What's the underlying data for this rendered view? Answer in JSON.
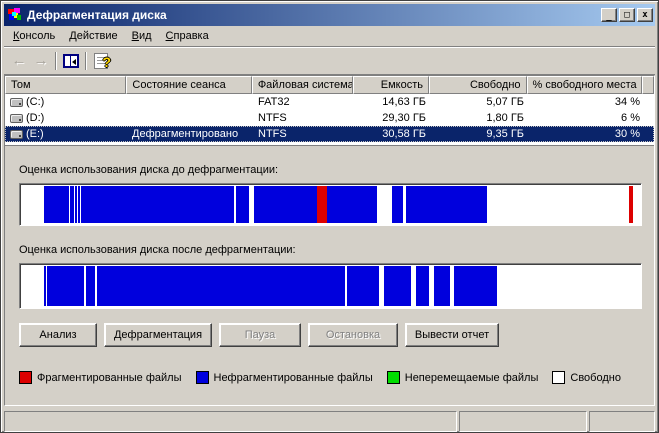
{
  "window": {
    "title": "Дефрагментация диска",
    "controls": {
      "minimize": "_",
      "maximize": "□",
      "close": "x"
    }
  },
  "menu": {
    "items": [
      {
        "label": "Консоль"
      },
      {
        "label": "Действие"
      },
      {
        "label": "Вид"
      },
      {
        "label": "Справка"
      }
    ]
  },
  "toolbar": {
    "icons": [
      "back-arrow",
      "forward-arrow",
      "show-console-tree",
      "help"
    ],
    "back_glyph": "←",
    "forward_glyph": "→",
    "help_glyph": "?"
  },
  "table": {
    "columns": [
      {
        "label": "Том"
      },
      {
        "label": "Состояние сеанса"
      },
      {
        "label": "Файловая система"
      },
      {
        "label": "Емкость"
      },
      {
        "label": "Свободно"
      },
      {
        "label": "% свободного места"
      }
    ],
    "rows": [
      {
        "volume": "(C:)",
        "session_status": "",
        "file_system": "FAT32",
        "capacity": "14,63 ГБ",
        "free_space": "5,07 ГБ",
        "percent_free": "34 %",
        "selected": false
      },
      {
        "volume": "(D:)",
        "session_status": "",
        "file_system": "NTFS",
        "capacity": "29,30 ГБ",
        "free_space": "1,80 ГБ",
        "percent_free": "6 %",
        "selected": false
      },
      {
        "volume": "(E:)",
        "session_status": "Дефрагментировано",
        "file_system": "NTFS",
        "capacity": "30,58 ГБ",
        "free_space": "9,35 ГБ",
        "percent_free": "30 %",
        "selected": true
      }
    ]
  },
  "usage": {
    "before_label": "Оценка использования диска до дефрагментации:",
    "after_label": "Оценка использования диска после дефрагментации:",
    "before_segments": [
      [
        "w",
        22
      ],
      [
        "b",
        25
      ],
      [
        "w",
        1
      ],
      [
        "b",
        4
      ],
      [
        "w",
        1
      ],
      [
        "b",
        2
      ],
      [
        "w",
        1
      ],
      [
        "b",
        2
      ],
      [
        "w",
        1
      ],
      [
        "b",
        152
      ],
      [
        "w",
        2
      ],
      [
        "b",
        13
      ],
      [
        "w",
        5
      ],
      [
        "b",
        63
      ],
      [
        "r",
        10
      ],
      [
        "b",
        50
      ],
      [
        "w",
        15
      ],
      [
        "b",
        11
      ],
      [
        "w",
        3
      ],
      [
        "b",
        81
      ],
      [
        "w",
        141
      ],
      [
        "r",
        4
      ],
      [
        "w",
        6
      ]
    ],
    "after_segments": [
      [
        "w",
        22
      ],
      [
        "b",
        2
      ],
      [
        "w",
        1
      ],
      [
        "b",
        37
      ],
      [
        "w",
        2
      ],
      [
        "b",
        9
      ],
      [
        "w",
        2
      ],
      [
        "b",
        250
      ],
      [
        "w",
        2
      ],
      [
        "b",
        32
      ],
      [
        "w",
        5
      ],
      [
        "b",
        27
      ],
      [
        "w",
        5
      ],
      [
        "b",
        13
      ],
      [
        "w",
        5
      ],
      [
        "b",
        16
      ],
      [
        "w",
        4
      ],
      [
        "b",
        43
      ],
      [
        "w",
        143
      ]
    ]
  },
  "buttons": [
    {
      "label": "Анализ",
      "enabled": true
    },
    {
      "label": "Дефрагментация",
      "enabled": true
    },
    {
      "label": "Пауза",
      "enabled": false
    },
    {
      "label": "Остановка",
      "enabled": false
    },
    {
      "label": "Вывести отчет",
      "enabled": true
    }
  ],
  "legend": [
    {
      "label": "Фрагментированные файлы",
      "color": "#dd0000"
    },
    {
      "label": "Нефрагментированные файлы",
      "color": "#0000dd"
    },
    {
      "label": "Неперемещаемые файлы",
      "color": "#00dd00"
    },
    {
      "label": "Свободно",
      "color": "#ffffff"
    }
  ],
  "colors": {
    "window_bg": "#d4d0c8",
    "title_gradient_start": "#0a246a",
    "title_gradient_end": "#a6caf0",
    "selection": "#0a246a",
    "segment_map": {
      "w": "#ffffff",
      "b": "#0000dd",
      "r": "#dd0000"
    }
  }
}
